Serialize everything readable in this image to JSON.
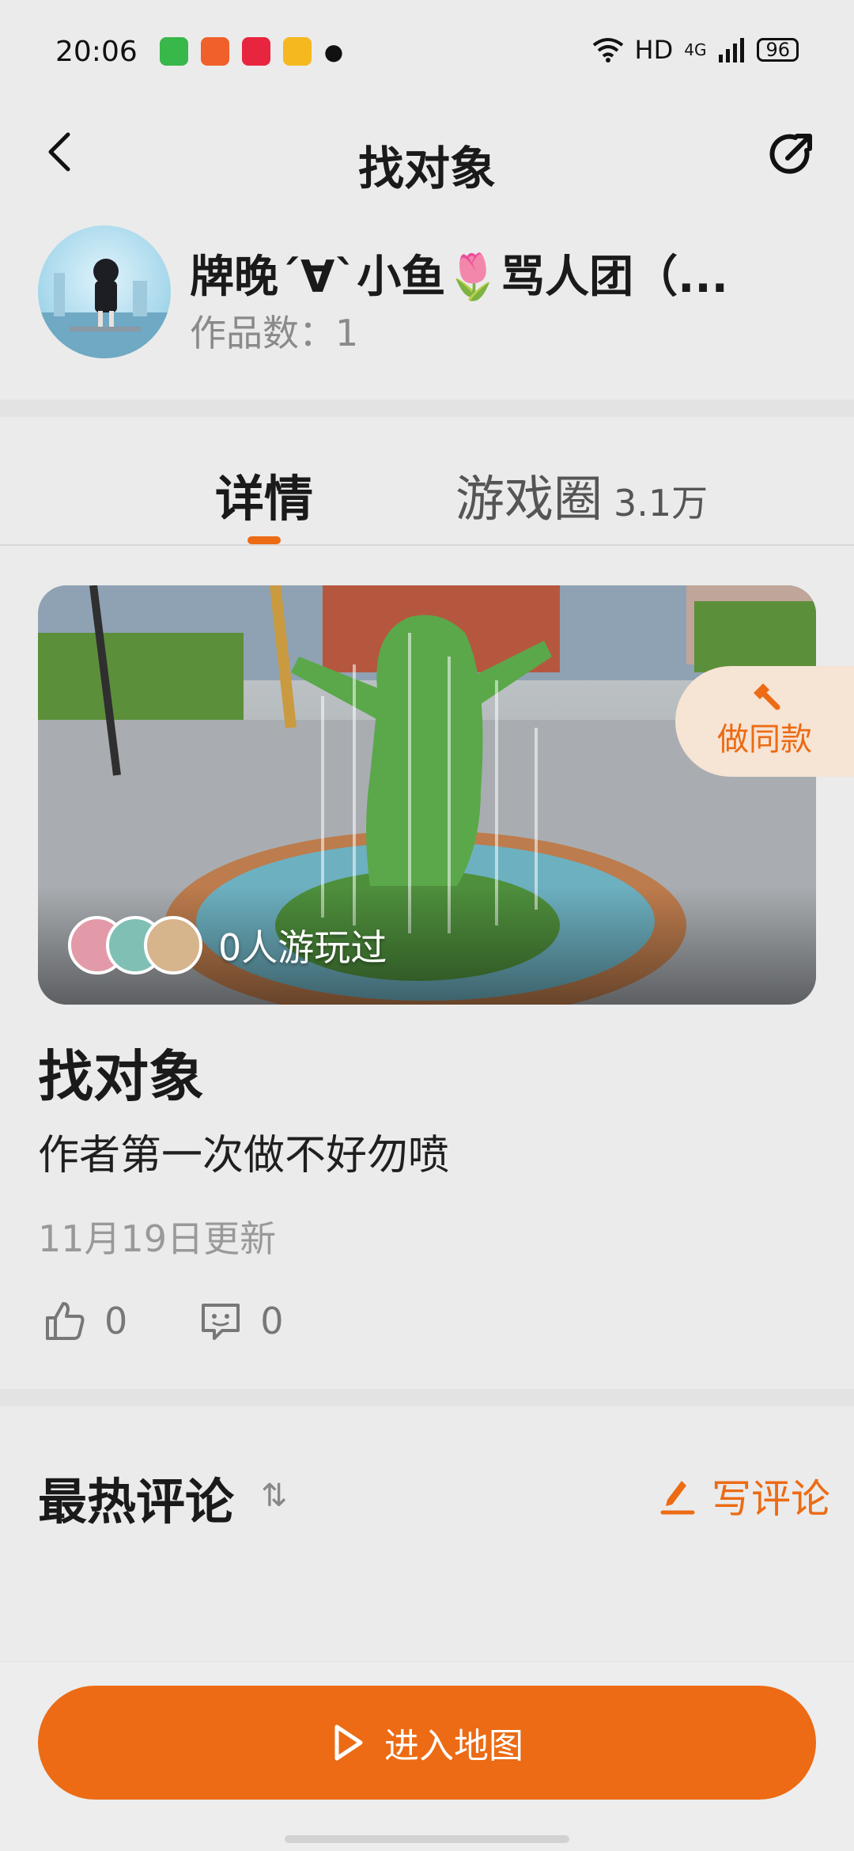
{
  "status_bar": {
    "time": "20:06",
    "network": "HD",
    "signal": "4G",
    "battery": "96",
    "app_icon_colors": [
      "#38b74a",
      "#f0602a",
      "#e8253f",
      "#f5b81f"
    ]
  },
  "nav": {
    "title": "找对象"
  },
  "author": {
    "name": "牌晚´∀`小鱼🌷骂人团（...",
    "works_label": "作品数：1"
  },
  "tabs": [
    {
      "label": "详情",
      "active": true
    },
    {
      "label": "游戏圈",
      "count": "3.1万",
      "active": false
    }
  ],
  "cover": {
    "played_text": "0人游玩过",
    "remake_label": "做同款"
  },
  "game": {
    "title": "找对象",
    "description": "作者第一次做不好勿喷",
    "updated": "11月19日更新",
    "likes": "0",
    "comments": "0"
  },
  "comments_section": {
    "title": "最热评论",
    "sort_symbol": "⇅",
    "write_label": "写评论"
  },
  "actions": {
    "enter_map_label": "进入地图"
  },
  "colors": {
    "accent": "#ec6b14",
    "background": "#ebebeb"
  }
}
